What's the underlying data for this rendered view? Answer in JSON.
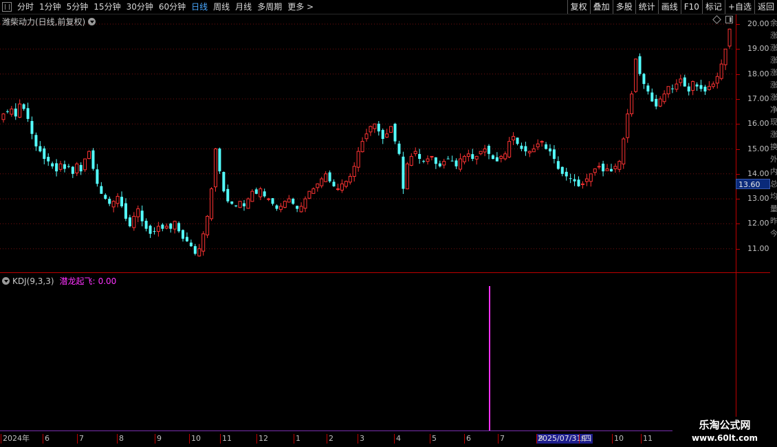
{
  "toolbar": {
    "periods": [
      {
        "label": "分时",
        "active": false
      },
      {
        "label": "1分钟",
        "active": false
      },
      {
        "label": "5分钟",
        "active": false
      },
      {
        "label": "15分钟",
        "active": false
      },
      {
        "label": "30分钟",
        "active": false
      },
      {
        "label": "60分钟",
        "active": false
      },
      {
        "label": "日线",
        "active": true
      },
      {
        "label": "周线",
        "active": false
      },
      {
        "label": "月线",
        "active": false
      },
      {
        "label": "多周期",
        "active": false
      },
      {
        "label": "更多 >",
        "active": false
      }
    ],
    "tools": [
      "复权",
      "叠加",
      "多股",
      "统计",
      "画线",
      "F10",
      "标记",
      "+自选",
      "返回"
    ]
  },
  "main_panel": {
    "title": "潍柴动力(日线,前复权)",
    "price_ticks": [
      "20.00",
      "19.00",
      "18.00",
      "17.00",
      "16.00",
      "15.00",
      "14.00",
      "13.00",
      "12.00",
      "11.00"
    ],
    "current_price": "13.60"
  },
  "kdj_panel": {
    "indicator": "KDJ(9,3,3)",
    "signal_label": "潜龙起飞:",
    "signal_value": "0.00"
  },
  "x_axis": {
    "labels": [
      "2024年",
      "6",
      "7",
      "8",
      "9",
      "10",
      "11",
      "12",
      "1",
      "2",
      "3",
      "4",
      "5",
      "6",
      "7",
      "8",
      "9",
      "10",
      "11"
    ],
    "selected_date": "2025/07/31/四"
  },
  "sidebar_text": [
    "余",
    "涨",
    "涨",
    "涨",
    "涨",
    "涨",
    "涨",
    "净",
    "现",
    "涨",
    "换",
    "外",
    "内",
    "总",
    "均",
    "量",
    "昨",
    "今"
  ],
  "watermark": {
    "name": "乐淘公式网",
    "url": "www.60lt.com"
  },
  "colors": {
    "up": "#ff3333",
    "down": "#54ffff",
    "signal": "#ff33ff",
    "axis": "#c00000",
    "active_period": "#4aa8ff"
  },
  "chart_data": {
    "type": "candlestick",
    "title": "潍柴动力(日线,前复权)",
    "ylim": [
      10.6,
      20.3
    ],
    "y_ticks": [
      11,
      12,
      13,
      14,
      15,
      16,
      17,
      18,
      19,
      20
    ],
    "x_ticks": [
      "2024年",
      "6",
      "7",
      "8",
      "9",
      "10",
      "11",
      "12",
      "1",
      "2",
      "3",
      "4",
      "5",
      "6",
      "7",
      "8",
      "9",
      "10",
      "11"
    ],
    "close_series_approx": [
      16.4,
      16.5,
      16.6,
      16.3,
      16.8,
      16.6,
      16.2,
      15.6,
      15.1,
      14.9,
      14.6,
      14.5,
      14.3,
      14.1,
      14.4,
      14.2,
      14.3,
      14.0,
      14.4,
      14.1,
      14.6,
      14.9,
      14.2,
      13.6,
      13.2,
      13.0,
      12.8,
      12.9,
      13.1,
      12.7,
      12.2,
      11.9,
      12.3,
      12.6,
      12.1,
      11.8,
      11.6,
      11.7,
      11.9,
      11.8,
      11.9,
      11.8,
      12.1,
      11.7,
      11.4,
      11.3,
      11.1,
      10.8,
      11.0,
      11.6,
      12.3,
      13.4,
      15.0,
      14.1,
      13.3,
      12.9,
      12.8,
      12.7,
      12.9,
      12.7,
      13.0,
      13.3,
      13.2,
      13.4,
      13.1,
      13.0,
      12.8,
      12.6,
      12.7,
      12.9,
      13.0,
      12.8,
      12.6,
      12.7,
      13.0,
      13.3,
      13.4,
      13.6,
      13.8,
      14.0,
      13.7,
      13.5,
      13.4,
      13.6,
      13.7,
      13.9,
      14.3,
      14.9,
      15.3,
      15.6,
      15.9,
      16.0,
      15.7,
      15.4,
      15.6,
      15.9,
      15.3,
      14.8,
      13.4,
      14.4,
      14.7,
      14.9,
      14.6,
      14.5,
      14.6,
      14.7,
      14.4,
      14.3,
      14.5,
      14.6,
      14.5,
      14.3,
      14.6,
      14.7,
      14.8,
      14.6,
      14.7,
      14.9,
      15.0,
      14.8,
      14.6,
      14.5,
      14.7,
      14.8,
      15.3,
      15.5,
      15.2,
      15.0,
      14.9,
      14.9,
      15.0,
      15.2,
      15.3,
      15.0,
      14.9,
      14.6,
      14.2,
      14.0,
      13.9,
      13.8,
      13.7,
      13.5,
      13.6,
      13.8,
      14.0,
      14.2,
      14.3,
      14.1,
      14.2,
      14.1,
      14.3,
      14.5,
      15.4,
      16.4,
      17.2,
      18.6,
      18.0,
      17.6,
      17.3,
      16.9,
      16.7,
      17.0,
      17.2,
      17.5,
      17.4,
      17.6,
      17.8,
      17.5,
      17.3,
      17.7,
      17.5,
      17.4,
      17.3,
      17.5,
      17.6,
      17.9,
      18.4,
      19.0,
      19.8
    ],
    "kdj_signal_series": {
      "name": "潜龙起飞",
      "value_shown": "0.00",
      "spike_date": "2025/07/31/四"
    }
  }
}
